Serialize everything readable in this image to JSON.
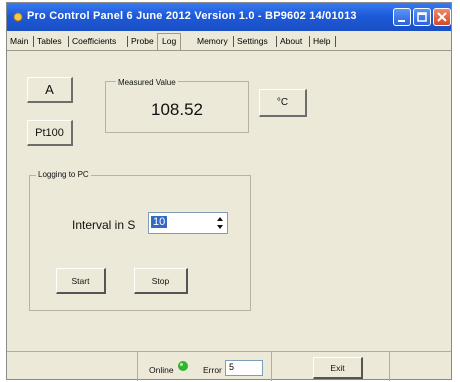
{
  "window": {
    "title": "Pro Control Panel 6 June 2012 Version 1.0 - BP9602 14/01013"
  },
  "tabs": [
    {
      "label": "Main"
    },
    {
      "label": "Tables"
    },
    {
      "label": "Coefficients"
    },
    {
      "label": "Probe"
    },
    {
      "label": "Log"
    },
    {
      "label": "Memory"
    },
    {
      "label": "Settings"
    },
    {
      "label": "About"
    },
    {
      "label": "Help"
    }
  ],
  "active_tab": "Log",
  "main": {
    "channel": "A",
    "sensor": "Pt100",
    "measured_label": "Measured Value",
    "measured_value": "108.52",
    "unit": "°C"
  },
  "logging": {
    "group_label": "Logging to PC",
    "interval_label": "Interval in S",
    "interval_value": "10",
    "start_label": "Start",
    "stop_label": "Stop"
  },
  "status": {
    "online_label": "Online",
    "online_color": "#2fb52f",
    "error_label": "Error",
    "error_value": "5",
    "exit_label": "Exit"
  },
  "colors": {
    "titlebar": "#1d5ad8",
    "window_bg": "#ece9d8"
  }
}
